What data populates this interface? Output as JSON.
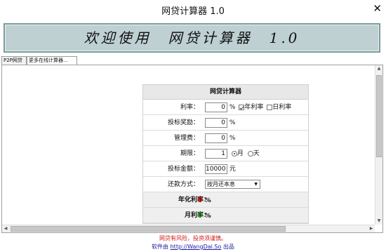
{
  "window": {
    "title": "网贷计算器 1.0"
  },
  "banner": {
    "text": "欢迎使用　网贷计算器　1.0"
  },
  "tabs": [
    {
      "label": "P2P网贷"
    },
    {
      "label": "更多在线计算器…"
    }
  ],
  "calculator": {
    "title": "网贷计算器",
    "rate": {
      "label": "利率：",
      "value": "0",
      "unit": "%",
      "year_option": "年利率",
      "day_option": "日利率",
      "year_checked": true,
      "day_checked": false
    },
    "bonus": {
      "label": "投标奖励：",
      "value": "0",
      "unit": "%"
    },
    "fee": {
      "label": "管理费：",
      "value": "0",
      "unit": "%"
    },
    "term": {
      "label": "期限：",
      "value": "1",
      "month_option": "月",
      "day_option": "天",
      "selected": "月"
    },
    "amount": {
      "label": "投标金额：",
      "value": "10000",
      "unit": "元"
    },
    "repay": {
      "label": "还款方式：",
      "selected": "按月还本息"
    },
    "annual_rate": {
      "label": "年化利率：",
      "value": "0",
      "unit": "%"
    },
    "monthly_rate": {
      "label": "月利率：",
      "value": "0",
      "unit": "%"
    }
  },
  "footer": {
    "warning": "网贷有风险，投资须谨慎。",
    "credit_prefix": "软件由",
    "credit_link": "http://WangDai.So",
    "credit_suffix": "出品"
  },
  "colors": {
    "banner_bg": "#bed0d2",
    "banner_border": "#7a9a9c",
    "warning": "#d01818",
    "result_green": "#2d9a2d",
    "result_red": "#d01818"
  },
  "icons": {
    "close": "close-icon",
    "select_arrow": "chevron-down-icon"
  }
}
